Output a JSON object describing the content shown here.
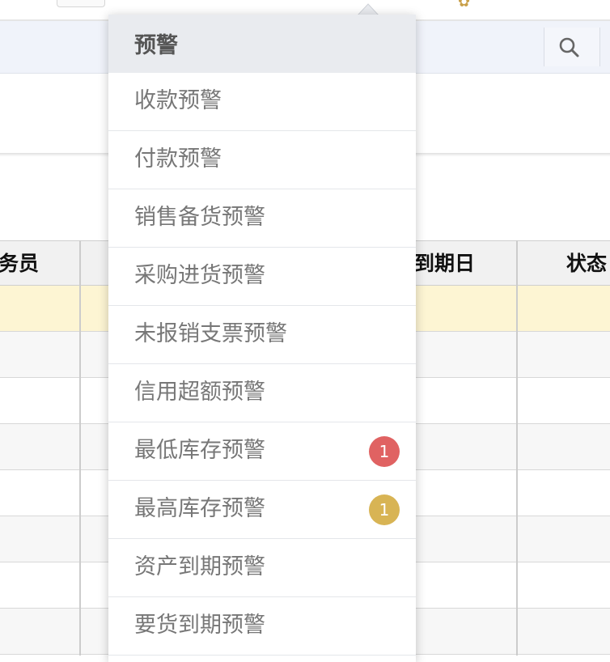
{
  "table": {
    "headers": {
      "salesperson": "务员",
      "due_date": "到期日",
      "status": "状态"
    },
    "highlight_color": "#fdf5d3"
  },
  "menu": {
    "header": "预警",
    "items": [
      {
        "label": "收款预警"
      },
      {
        "label": "付款预警"
      },
      {
        "label": "销售备货预警"
      },
      {
        "label": "采购进货预警"
      },
      {
        "label": "未报销支票预警"
      },
      {
        "label": "信用超额预警"
      },
      {
        "label": "最低库存预警",
        "badge": "1",
        "badge_color": "#e06262"
      },
      {
        "label": "最高库存预警",
        "badge": "1",
        "badge_color": "#d8b454"
      },
      {
        "label": "资产到期预警"
      },
      {
        "label": "要货到期预警"
      }
    ]
  },
  "icons": {
    "search": "search-icon",
    "settings": "gear-icon"
  }
}
